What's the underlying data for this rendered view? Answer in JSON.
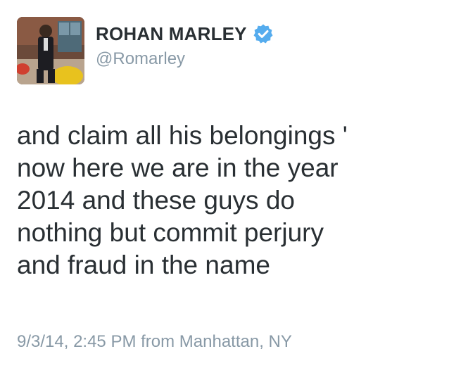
{
  "author": {
    "display_name": "ROHAN MARLEY",
    "handle": "@Romarley",
    "verified": true,
    "verified_icon": "verified-badge-icon",
    "verified_color": "#55acee"
  },
  "tweet": {
    "lines": [
      "and claim all his belongings '",
      "now here we are in the year",
      "2014 and these guys do",
      "nothing but commit perjury",
      "and fraud in the name"
    ]
  },
  "meta": {
    "timestamp": "9/3/14, 2:45 PM from Manhattan, NY"
  },
  "colors": {
    "text": "#292f33",
    "secondary": "#8899a6",
    "accent": "#55acee"
  }
}
